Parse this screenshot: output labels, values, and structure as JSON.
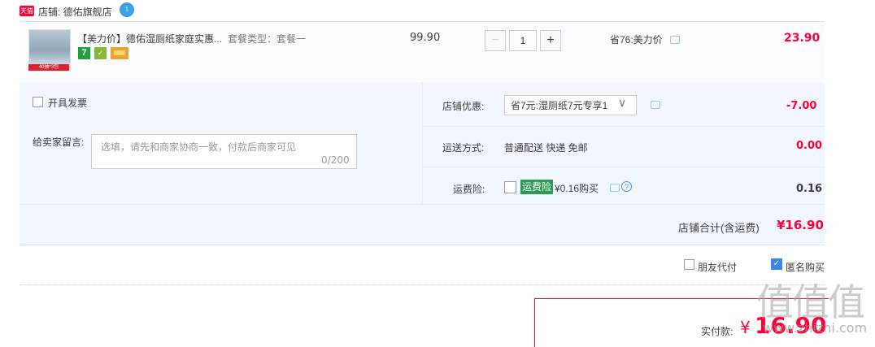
{
  "shop": {
    "badge": "天猫",
    "name": "店铺: 德佑旗舰店",
    "ww_badge": "1"
  },
  "item": {
    "title": "【美力价】德佑湿厕纸家庭实惠...",
    "sku": "套餐类型：套餐一",
    "price": "99.90",
    "quantity": "1",
    "qty_minus": "−",
    "qty_plus": "+",
    "promo": "省76:美力价",
    "total": "23.90",
    "thumb_strip": "40抽*3包",
    "tag_seven": "7",
    "tag_b": "✓"
  },
  "options": {
    "invoice_label": "开具发票",
    "message_label": "给卖家留言:",
    "message_placeholder": "选填，请先和商家协商一致，付款后商家可见",
    "message_count": "0/200",
    "coupon_label": "店铺优惠:",
    "coupon_value": "省7元:湿厕纸7元专享1",
    "coupon_amount": "-7.00",
    "shipping_label": "运送方式:",
    "shipping_value": "普通配送 快递 免邮",
    "shipping_amount": "0.00",
    "insurance_label": "运费险:",
    "insurance_badge": "运费险",
    "insurance_price": "¥0.16购买",
    "insurance_amount": "0.16",
    "help": "?"
  },
  "subtotal": {
    "label": "店铺合计(含运费)",
    "value": "¥16.90"
  },
  "bottom": {
    "friend_pay": "朋友代付",
    "anonymous": "匿名购买",
    "anonymous_check": "✓",
    "pay_label": "实付款:",
    "pay_yen": "¥",
    "pay_amount": "16.90"
  },
  "watermark": {
    "logo": "值值值",
    "url": "www.zhizhi.com"
  },
  "colors": {
    "accent_red": "#ff0036",
    "panel_bg": "#f2f7ff",
    "check_blue": "#3b86e8",
    "insurance_green": "#2d9a53"
  }
}
